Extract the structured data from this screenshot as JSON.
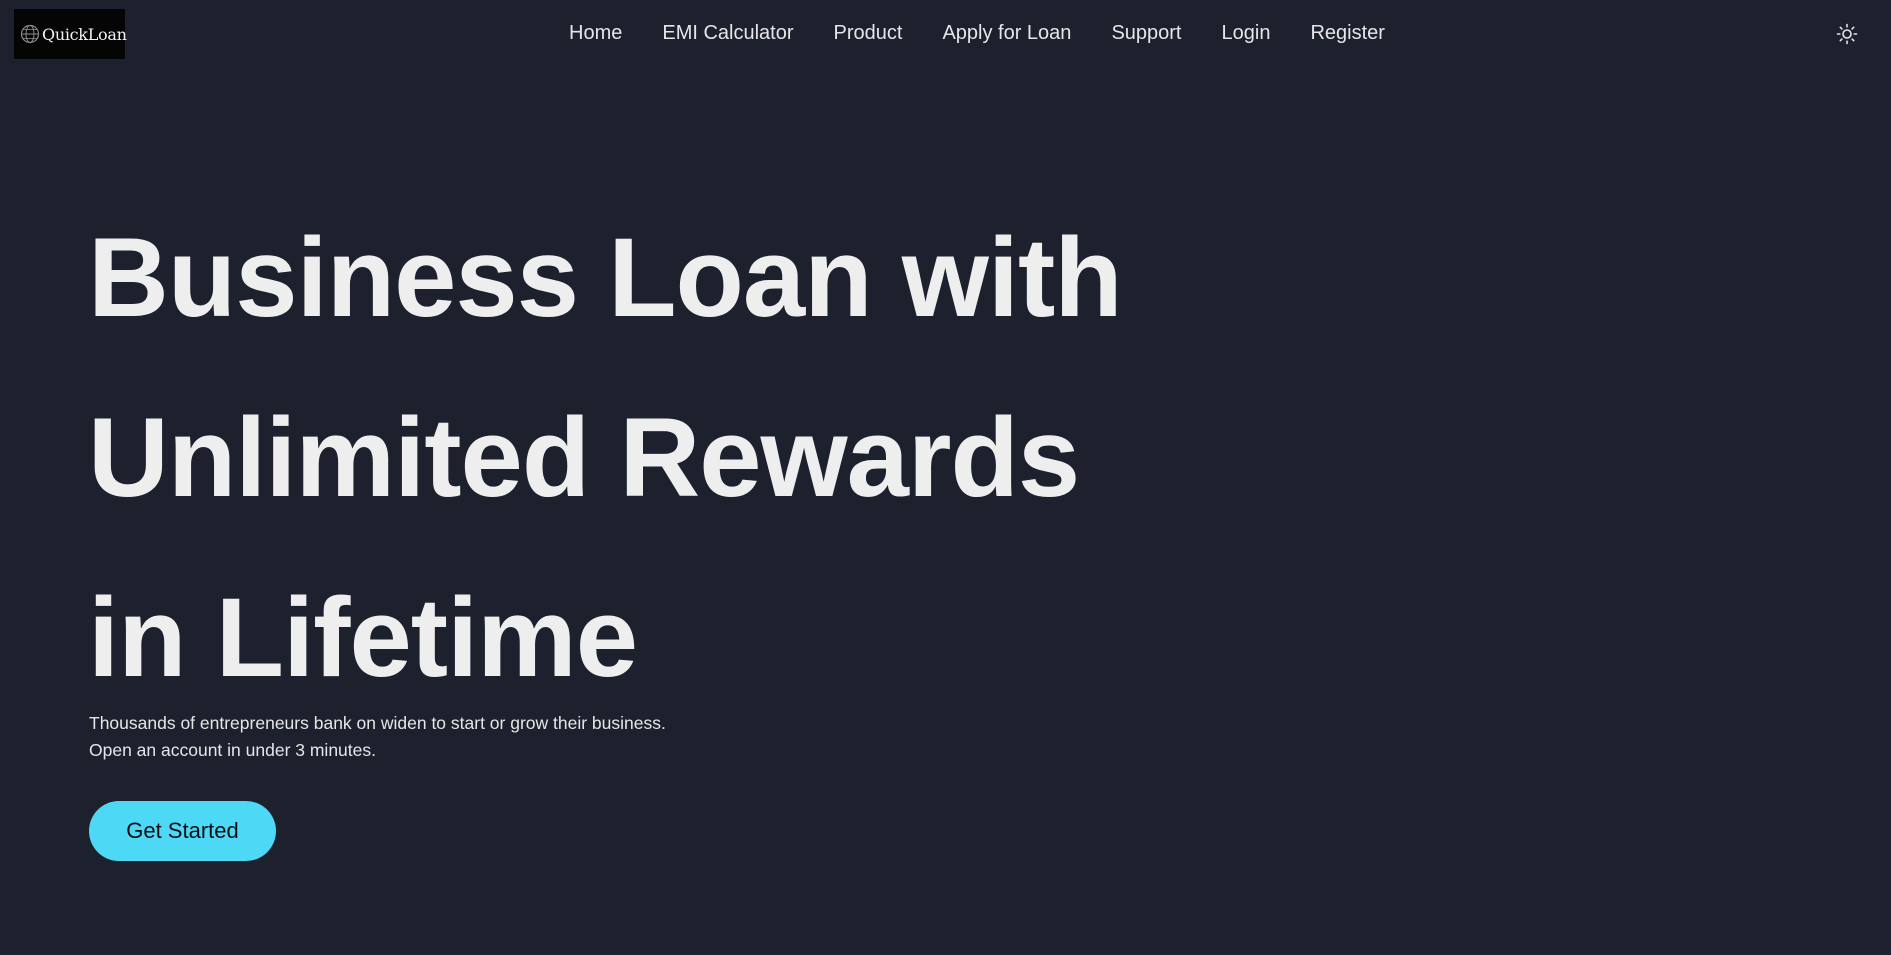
{
  "brand": {
    "name": "QuickLoan",
    "icon": "globe-icon"
  },
  "nav": {
    "items": [
      {
        "label": "Home"
      },
      {
        "label": "EMI Calculator"
      },
      {
        "label": "Product"
      },
      {
        "label": "Apply for Loan"
      },
      {
        "label": "Support"
      },
      {
        "label": "Login"
      },
      {
        "label": "Register"
      }
    ],
    "theme_toggle_icon": "sun-icon"
  },
  "hero": {
    "title_lines": [
      "Business Loan with",
      "Unlimited Rewards",
      "in Lifetime"
    ],
    "subtitle_lines": [
      "Thousands of entrepreneurs bank on widen to start or grow their business.",
      "Open an account in under 3 minutes."
    ],
    "cta_label": "Get Started"
  },
  "colors": {
    "background": "#1c212d",
    "accent": "#4dd9f5",
    "text": "#eeeeee",
    "logo_bg": "#050505"
  }
}
